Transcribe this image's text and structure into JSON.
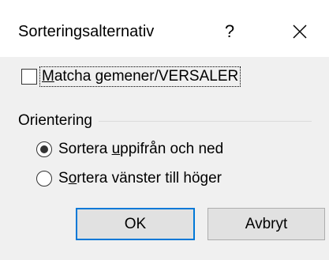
{
  "dialog": {
    "title": "Sorteringsalternativ",
    "help_label": "?",
    "close_icon": "close-icon"
  },
  "options": {
    "case_checkbox": {
      "label_underlined": "M",
      "label_rest": "atcha gemener/VERSALER",
      "checked": false
    }
  },
  "orientation": {
    "title": "Orientering",
    "top_to_bottom": {
      "label_before": "Sortera ",
      "label_underlined": "u",
      "label_after": "ppifrån och ned",
      "selected": true
    },
    "left_to_right": {
      "label_before": "S",
      "label_underlined": "o",
      "label_after": "rtera vänster till höger",
      "selected": false
    }
  },
  "buttons": {
    "ok_label": "OK",
    "cancel_label": "Avbryt"
  },
  "colors": {
    "content_background": "#f0f0f0",
    "default_button_border": "#0078d7"
  }
}
